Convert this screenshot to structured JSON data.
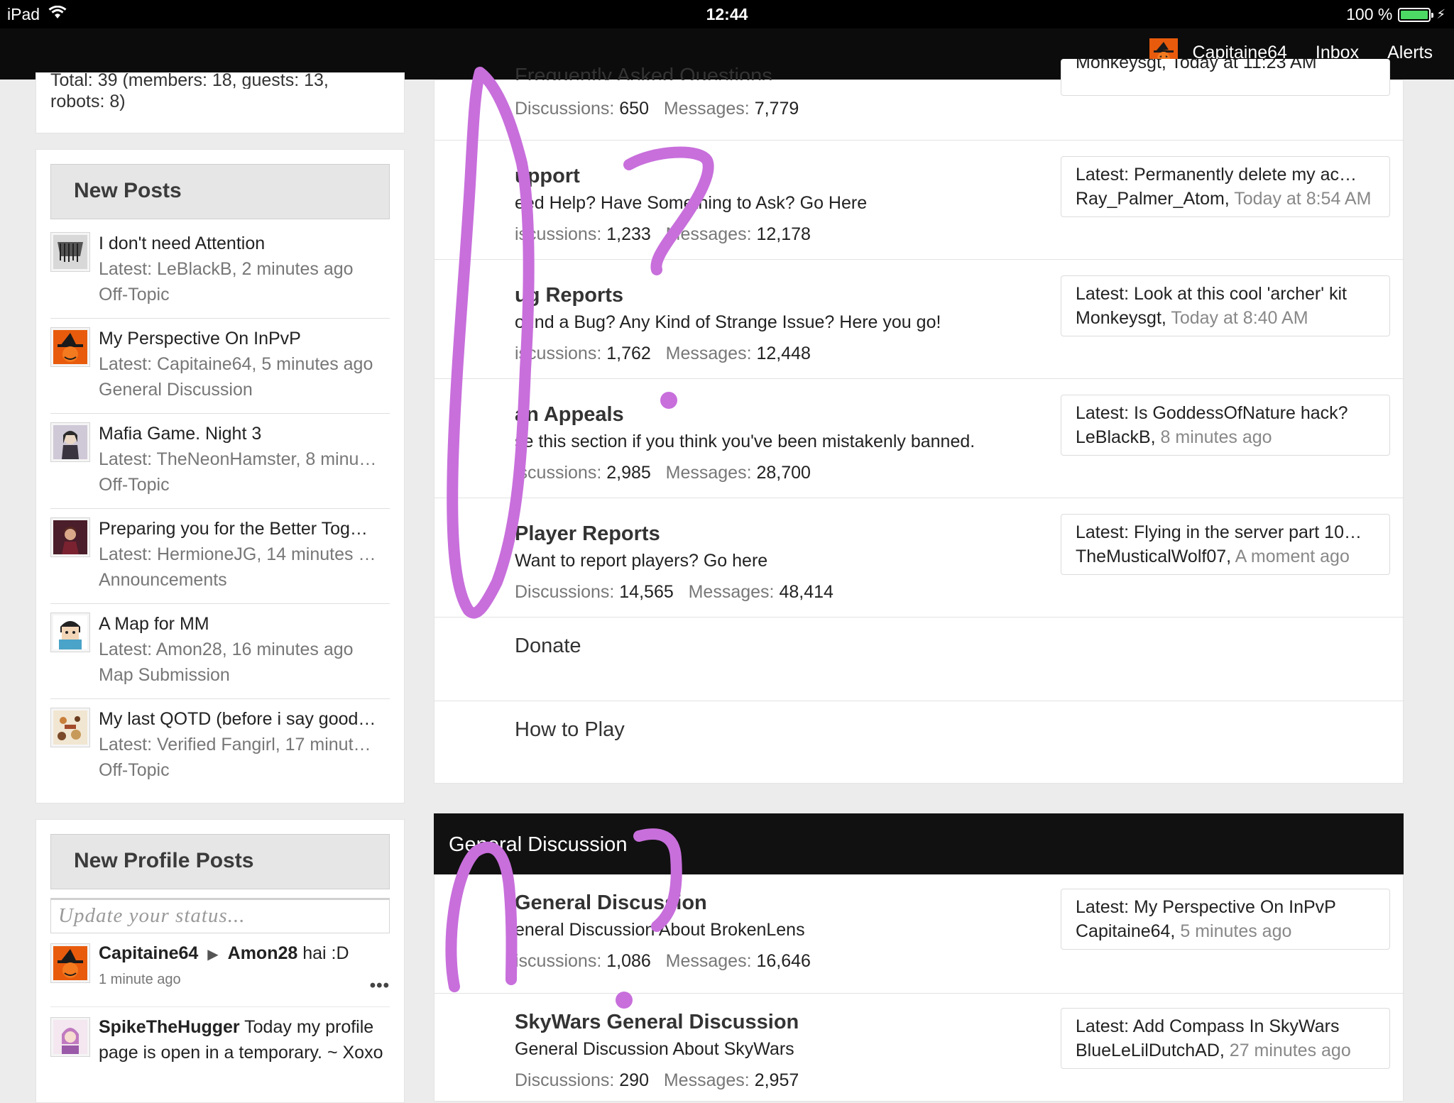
{
  "status_bar": {
    "device": "iPad",
    "time": "12:44",
    "battery": "100 %"
  },
  "nav": {
    "username": "Capitaine64",
    "inbox": "Inbox",
    "alerts": "Alerts"
  },
  "sidebar": {
    "online_partial_1": "Total: 39 (members: 18, guests: 13,",
    "online_partial_2": "robots: 8)",
    "new_posts": {
      "heading": "New Posts",
      "items": [
        {
          "title": "I don't need Attention",
          "latest": "Latest: LeBlackB, 2 minutes ago",
          "forum": "Off-Topic"
        },
        {
          "title": "My Perspective On InPvP",
          "latest": "Latest: Capitaine64, 5 minutes ago",
          "forum": "General Discussion"
        },
        {
          "title": "Mafia Game. Night 3",
          "latest": "Latest: TheNeonHamster, 8 minu…",
          "forum": "Off-Topic"
        },
        {
          "title": "Preparing you for the Better Tog…",
          "latest": "Latest: HermioneJG, 14 minutes …",
          "forum": "Announcements"
        },
        {
          "title": "A Map for MM",
          "latest": "Latest: Amon28, 16 minutes ago",
          "forum": "Map Submission"
        },
        {
          "title": "My last QOTD (before i say good…",
          "latest": "Latest: Verified Fangirl, 17 minut…",
          "forum": "Off-Topic"
        }
      ]
    },
    "new_profile_posts": {
      "heading": "New Profile Posts",
      "placeholder": "Update your status...",
      "posts": [
        {
          "author": "Capitaine64",
          "arrow": "▶",
          "target": "Amon28",
          "text": "hai :D",
          "time": "1 minute ago",
          "more": "•••"
        },
        {
          "author": "SpikeTheHugger",
          "text": "Today my profile page is open in a temporary. ~ Xoxo"
        }
      ]
    }
  },
  "forums": {
    "faq": {
      "title_partial": "Frequently Asked Questions",
      "discussions_label": "Discussions:",
      "discussions": "650",
      "messages_label": "Messages:",
      "messages": "7,779",
      "latest_partial": "Monkeysgt, Today at 11:23 AM"
    },
    "nodes": [
      {
        "title": "upport",
        "desc": "eed Help? Have Something to Ask? Go Here",
        "discussions_label": "iscussions:",
        "discussions": "1,233",
        "messages_label": "Messages:",
        "messages": "12,178",
        "latest_title": "Latest: Permanently delete my ac…",
        "latest_user": "Ray_Palmer_Atom,",
        "latest_time": "Today at 8:54 AM"
      },
      {
        "title": "ug Reports",
        "desc": "ound a Bug? Any Kind of Strange Issue? Here you go!",
        "discussions_label": "iscussions:",
        "discussions": "1,762",
        "messages_label": "Messages:",
        "messages": "12,448",
        "latest_title": "Latest: Look at this cool 'archer' kit",
        "latest_user": "Monkeysgt,",
        "latest_time": "Today at 8:40 AM"
      },
      {
        "title": "an Appeals",
        "desc": "se this section if you think you've been mistakenly banned.",
        "discussions_label": "iscussions:",
        "discussions": "2,985",
        "messages_label": "Messages:",
        "messages": "28,700",
        "latest_title": "Latest: Is GoddessOfNature hack?",
        "latest_user": "LeBlackB,",
        "latest_time": "8 minutes ago"
      },
      {
        "title": "Player Reports",
        "desc": "Want to report players? Go here",
        "discussions_label": "Discussions:",
        "discussions": "14,565",
        "messages_label": "Messages:",
        "messages": "48,414",
        "latest_title": "Latest: Flying in the server part 10…",
        "latest_user": "TheMusticalWolf07,",
        "latest_time": "A moment ago"
      }
    ],
    "links": [
      "Donate",
      "How to Play"
    ],
    "category": "General Discussion",
    "cat_nodes": [
      {
        "title": "General Discussion",
        "desc": "eneral Discussion About BrokenLens",
        "discussions_label": "iscussions:",
        "discussions": "1,086",
        "messages_label": "Messages:",
        "messages": "16,646",
        "latest_title": "Latest: My Perspective On InPvP",
        "latest_user": "Capitaine64,",
        "latest_time": "5 minutes ago"
      },
      {
        "title": "SkyWars General Discussion",
        "desc": "General Discussion About SkyWars",
        "discussions_label": "Discussions:",
        "discussions": "290",
        "messages_label": "Messages:",
        "messages": "2,957",
        "latest_title": "Latest: Add Compass In SkyWars",
        "latest_user": "BlueLeLilDutchAD,",
        "latest_time": "27 minutes ago"
      }
    ]
  },
  "colors": {
    "accent_avatar": "#e85b0c",
    "annotation": "#c86fdc",
    "nav_bg": "#0c0c0c"
  }
}
